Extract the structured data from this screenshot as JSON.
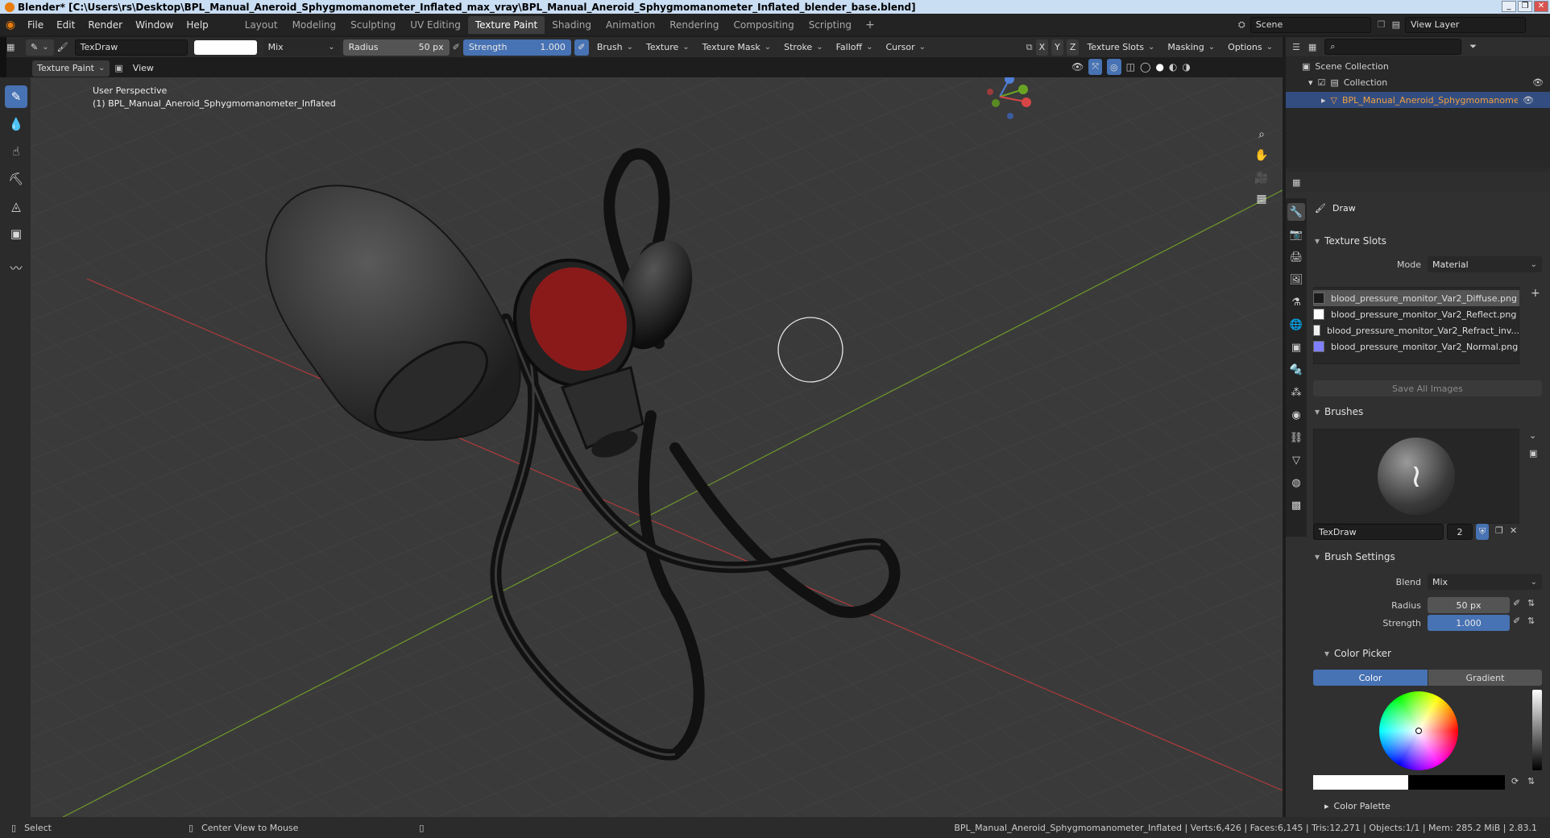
{
  "window": {
    "title": "Blender* [C:\\Users\\rs\\Desktop\\BPL_Manual_Aneroid_Sphygmomanometer_Inflated_max_vray\\BPL_Manual_Aneroid_Sphygmomanometer_Inflated_blender_base.blend]"
  },
  "menus": [
    "File",
    "Edit",
    "Render",
    "Window",
    "Help"
  ],
  "workspaces": [
    "Layout",
    "Modeling",
    "Sculpting",
    "UV Editing",
    "Texture Paint",
    "Shading",
    "Animation",
    "Rendering",
    "Compositing",
    "Scripting"
  ],
  "active_workspace": "Texture Paint",
  "scene": {
    "label": "Scene",
    "view_layer": "View Layer"
  },
  "tool_header": {
    "brush_name": "TexDraw",
    "blend": "Mix",
    "radius_label": "Radius",
    "radius_value": "50 px",
    "strength_label": "Strength",
    "strength_value": "1.000",
    "menus": [
      "Brush",
      "Texture",
      "Texture Mask",
      "Stroke",
      "Falloff",
      "Cursor"
    ],
    "axes": [
      "X",
      "Y",
      "Z"
    ],
    "right_menus": [
      "Texture Slots",
      "Masking",
      "Options"
    ]
  },
  "viewport_header": {
    "mode": "Texture Paint",
    "view": "View"
  },
  "viewport": {
    "perspective": "User Perspective",
    "object": "(1) BPL_Manual_Aneroid_Sphygmomanometer_Inflated"
  },
  "outliner": {
    "scene_collection": "Scene Collection",
    "collection": "Collection",
    "object": "BPL_Manual_Aneroid_Sphygmomanometer_I"
  },
  "properties": {
    "tool": "Draw",
    "texture_slots": {
      "title": "Texture Slots",
      "mode_label": "Mode",
      "mode_value": "Material",
      "slots": [
        {
          "name": "blood_pressure_monitor_Var2_Diffuse.png",
          "color": "#1a1a1a"
        },
        {
          "name": "blood_pressure_monitor_Var2_Reflect.png",
          "color": "#ffffff"
        },
        {
          "name": "blood_pressure_monitor_Var2_Refract_inv...",
          "color": "#f0f0f0"
        },
        {
          "name": "blood_pressure_monitor_Var2_Normal.png",
          "color": "#8080ff"
        }
      ],
      "save_all": "Save All Images"
    },
    "brushes": {
      "title": "Brushes",
      "name": "TexDraw",
      "users": "2"
    },
    "brush_settings": {
      "title": "Brush Settings",
      "blend_label": "Blend",
      "blend_value": "Mix",
      "radius_label": "Radius",
      "radius_value": "50 px",
      "strength_label": "Strength",
      "strength_value": "1.000"
    },
    "color_picker": {
      "title": "Color Picker",
      "tab_color": "Color",
      "tab_gradient": "Gradient"
    },
    "color_palette": "Color Palette"
  },
  "statusbar": {
    "select": "Select",
    "center_view": "Center View to Mouse",
    "stats": "BPL_Manual_Aneroid_Sphygmomanometer_Inflated | Verts:6,426 | Faces:6,145 | Tris:12,271 | Objects:1/1 | Mem: 285.2 MiB | 2.83.1"
  },
  "colors": {
    "accent": "#4772b3",
    "gauge_face": "#8a1a1a",
    "grid_x": "#b03a3a",
    "grid_y": "#6f9a2a"
  }
}
